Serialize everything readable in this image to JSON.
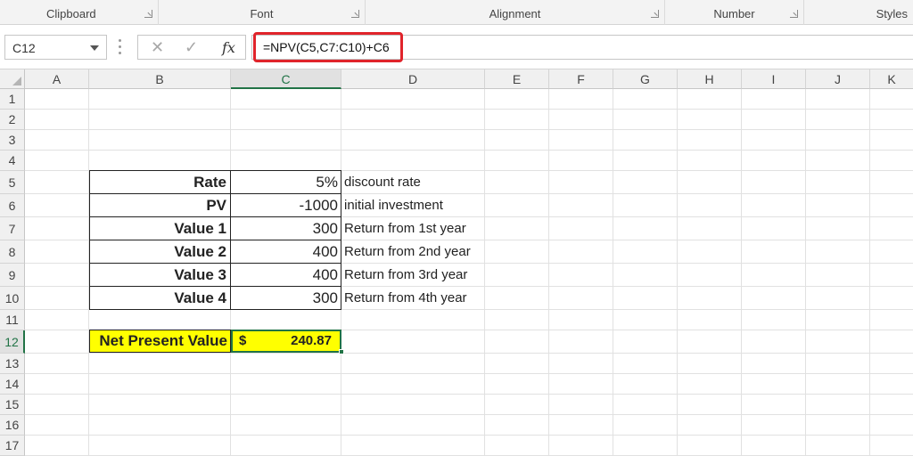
{
  "ribbon": {
    "groups": [
      {
        "label": "Clipboard"
      },
      {
        "label": "Font"
      },
      {
        "label": "Alignment"
      },
      {
        "label": "Number"
      },
      {
        "label": "Styles"
      }
    ]
  },
  "formula_bar": {
    "name_box": "C12",
    "cancel_glyph": "✕",
    "enter_glyph": "✓",
    "fx_glyph": "fx",
    "formula": "=NPV(C5,C7:C10)+C6"
  },
  "sheet": {
    "columns": [
      "A",
      "B",
      "C",
      "D",
      "E",
      "F",
      "G",
      "H",
      "I",
      "J",
      "K"
    ],
    "rows": [
      "1",
      "2",
      "3",
      "4",
      "5",
      "6",
      "7",
      "8",
      "9",
      "10",
      "11",
      "12",
      "13",
      "14",
      "15",
      "16",
      "17"
    ],
    "active_column": "C",
    "active_row": "12",
    "table": [
      {
        "label": "Rate",
        "value": "5%",
        "note": "discount rate"
      },
      {
        "label": "PV",
        "value": "-1000",
        "note": "initial investment"
      },
      {
        "label": "Value 1",
        "value": "300",
        "note": "Return from 1st year"
      },
      {
        "label": "Value 2",
        "value": "400",
        "note": "Return from 2nd year"
      },
      {
        "label": "Value 3",
        "value": "400",
        "note": "Return from 3rd year"
      },
      {
        "label": "Value 4",
        "value": "300",
        "note": "Return from 4th year"
      }
    ],
    "npv": {
      "label": "Net Present Value",
      "currency": "$",
      "value": "240.87",
      "highlight_color": "#ffff00"
    }
  },
  "colors": {
    "accent": "#217346",
    "highlight_border": "#e0242b"
  }
}
